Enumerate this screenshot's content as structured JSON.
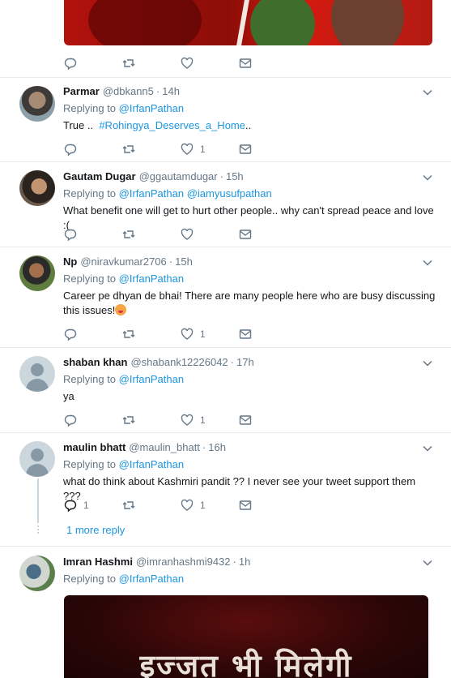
{
  "top_tweet": {
    "actions": {
      "reply_count": "",
      "retweet_count": "",
      "like_count": ""
    }
  },
  "tweets": [
    {
      "name": "Parmar",
      "handle": "@dbkann5",
      "time": "14h",
      "replying_prefix": "Replying to",
      "replying_to": [
        "@IrfanPathan"
      ],
      "text_plain": "True ..",
      "text_link": "#Rohingya_Deserves_a_Home",
      "text_suffix": "..",
      "reply_count": "",
      "like_count": "1"
    },
    {
      "name": "Gautam Dugar",
      "handle": "@ggautamdugar",
      "time": "15h",
      "replying_prefix": "Replying to",
      "replying_to": [
        "@IrfanPathan",
        "@iamyusufpathan"
      ],
      "text_plain": "What benefit one will get to hurt other people.. why can't spread peace and love :(",
      "reply_count": "",
      "like_count": ""
    },
    {
      "name": "Np",
      "handle": "@niravkumar2706",
      "time": "15h",
      "replying_prefix": "Replying to",
      "replying_to": [
        "@IrfanPathan"
      ],
      "text_plain": "Career pe dhyan de bhai! There are many people here who are busy discussing this issues!",
      "reply_count": "",
      "like_count": "1"
    },
    {
      "name": "shaban khan",
      "handle": "@shabank12226042",
      "time": "17h",
      "replying_prefix": "Replying to",
      "replying_to": [
        "@IrfanPathan"
      ],
      "text_plain": "ya",
      "reply_count": "",
      "like_count": "1"
    },
    {
      "name": "maulin bhatt",
      "handle": "@maulin_bhatt",
      "time": "16h",
      "replying_prefix": "Replying to",
      "replying_to": [
        "@IrfanPathan"
      ],
      "text_plain": "what do think about Kashmiri pandit ?? I never see your tweet support them ???",
      "reply_count": "1",
      "like_count": "1",
      "more_replies": "1 more reply"
    },
    {
      "name": "Imran Hashmi",
      "handle": "@imranhashmi9432",
      "time": "1h",
      "replying_prefix": "Replying to",
      "replying_to": [
        "@IrfanPathan"
      ],
      "image_text": "इज्जत भी मिलेगी"
    }
  ],
  "colors": {
    "link": "#1b95e0",
    "muted": "#657786",
    "text": "#14171a",
    "separator": "#e6ecf0"
  },
  "icons": [
    "reply-icon",
    "retweet-icon",
    "like-icon",
    "direct-message-icon",
    "chevron-down-icon"
  ]
}
